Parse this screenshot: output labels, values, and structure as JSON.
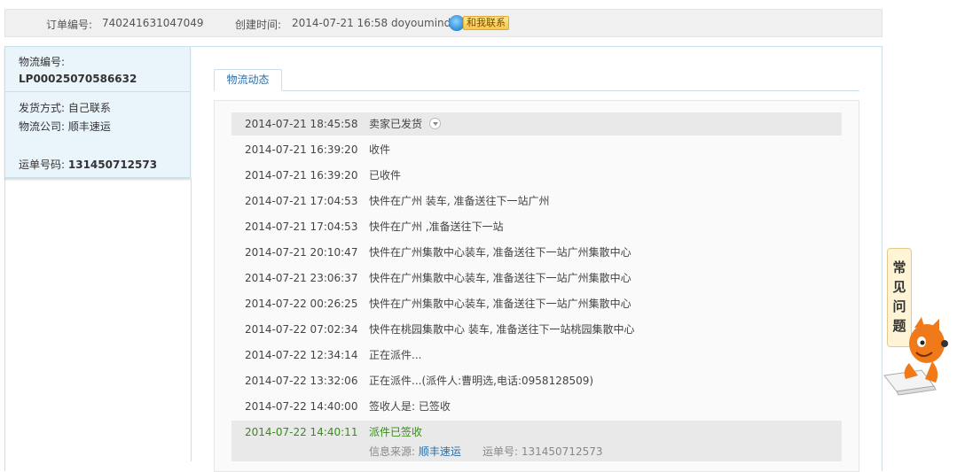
{
  "header": {
    "order_label": "订单编号:",
    "order_number": "740241631047049",
    "created_label": "创建时间:",
    "created_time": "2014-07-21 16:58",
    "seller": "doyoumind",
    "contact_button": "和我联系"
  },
  "sidebar": {
    "logistics_no_label": "物流编号:",
    "logistics_no": "LP00025070586632",
    "ship_method": "发货方式: 自己联系",
    "company": "物流公司: 顺丰速运",
    "waybill_label": "运单号码:",
    "waybill_no": "131450712573"
  },
  "tab": {
    "label": "物流动态"
  },
  "tracking": [
    {
      "time": "2014-07-21 18:45:58",
      "desc": "卖家已发货"
    },
    {
      "time": "2014-07-21 16:39:20",
      "desc": "收件"
    },
    {
      "time": "2014-07-21 16:39:20",
      "desc": "已收件"
    },
    {
      "time": "2014-07-21 17:04:53",
      "desc": "快件在广州 装车, 准备送往下一站广州"
    },
    {
      "time": "2014-07-21 17:04:53",
      "desc": "快件在广州 ,准备送往下一站"
    },
    {
      "time": "2014-07-21 20:10:47",
      "desc": "快件在广州集散中心装车, 准备送往下一站广州集散中心"
    },
    {
      "time": "2014-07-21 23:06:37",
      "desc": "快件在广州集散中心装车, 准备送往下一站广州集散中心"
    },
    {
      "time": "2014-07-22 00:26:25",
      "desc": "快件在广州集散中心装车, 准备送往下一站广州集散中心"
    },
    {
      "time": "2014-07-22 07:02:34",
      "desc": "快件在桃园集散中心 装车, 准备送往下一站桃园集散中心"
    },
    {
      "time": "2014-07-22 12:34:14",
      "desc": "正在派件..."
    },
    {
      "time": "2014-07-22 13:32:06",
      "desc": "正在派件...(派件人:曹明选,电话:0958128509)"
    },
    {
      "time": "2014-07-22 14:40:00",
      "desc": "签收人是: 已签收"
    },
    {
      "time": "2014-07-22 14:40:11",
      "desc": "派件已签收"
    }
  ],
  "source": {
    "label": "信息来源:",
    "company_link": "顺丰速运",
    "waybill_label": "运单号:",
    "waybill_no": "131450712573"
  },
  "faq": {
    "c1": "常",
    "c2": "见",
    "c3": "问",
    "c4": "题"
  },
  "colors": {
    "link": "#2b6ea6",
    "signed": "#3a8a1e",
    "sidebar_bg": "#eaf4fb"
  }
}
